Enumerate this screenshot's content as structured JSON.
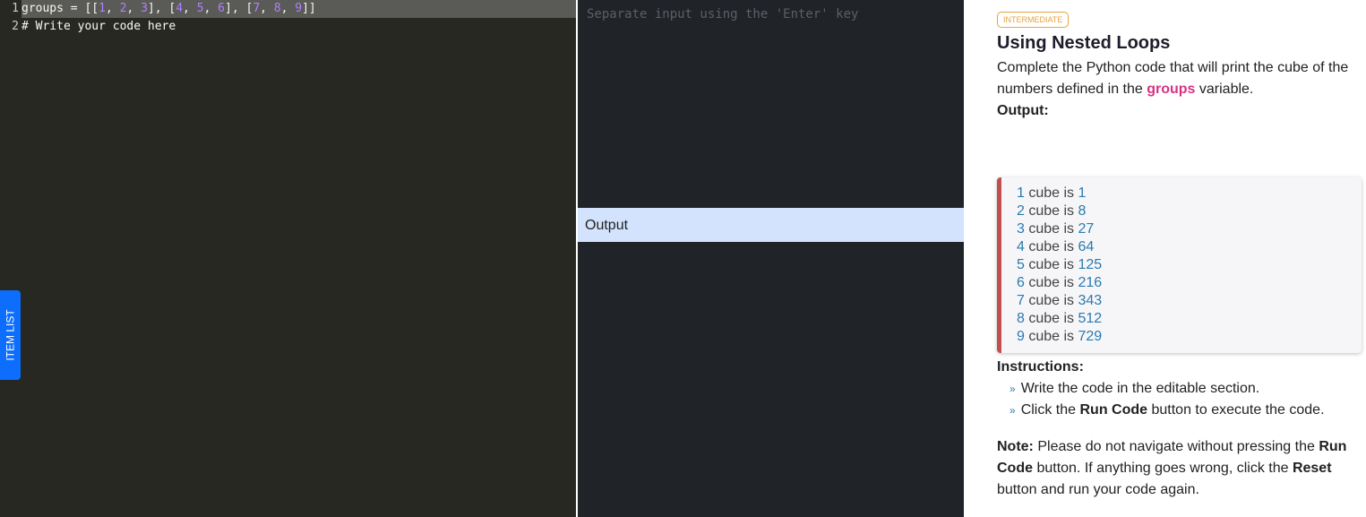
{
  "editor": {
    "lines": [
      {
        "n": "1",
        "text": "groups = [[1, 2, 3], [4, 5, 6], [7, 8, 9]]"
      },
      {
        "n": "2",
        "text": "# Write your code here"
      }
    ]
  },
  "sidebar_tab": "ITEM LIST",
  "io": {
    "input_placeholder": "Separate input using the 'Enter' key",
    "output_label": "Output"
  },
  "panel": {
    "badge": "INTERMEDIATE",
    "title": "Using Nested Loops",
    "desc_pre": "Complete the Python code that will print the cube of the numbers defined in the ",
    "desc_var": "groups",
    "desc_post": " variable.",
    "output_label": "Output:",
    "output_lines": [
      [
        "1",
        "1"
      ],
      [
        "2",
        "8"
      ],
      [
        "3",
        "27"
      ],
      [
        "4",
        "64"
      ],
      [
        "5",
        "125"
      ],
      [
        "6",
        "216"
      ],
      [
        "7",
        "343"
      ],
      [
        "8",
        "512"
      ],
      [
        "9",
        "729"
      ]
    ],
    "output_mid": " cube is ",
    "instructions_label": "Instructions:",
    "inst1": "Write the code in the editable section.",
    "inst2_pre": "Click the ",
    "inst2_bold": "Run Code",
    "inst2_post": " button to execute the code.",
    "note_label": "Note:",
    "note_1": " Please do not navigate without pressing the ",
    "note_b1": "Run Code",
    "note_2": " button. If anything goes wrong, click the ",
    "note_b2": "Reset",
    "note_3": " button and run your code again."
  },
  "colors": {
    "accent": "#0d6efd",
    "badge": "#e8a33d",
    "highlight": "#d63384"
  }
}
